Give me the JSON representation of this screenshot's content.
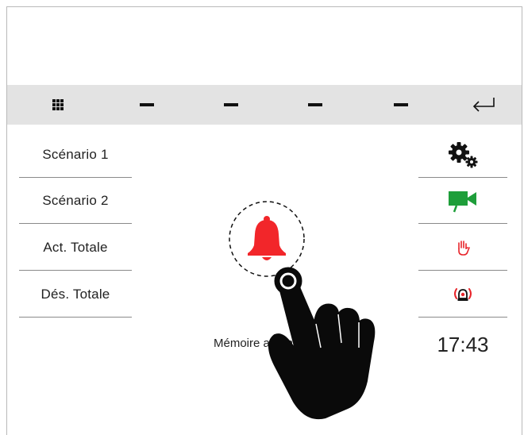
{
  "toolbar": {
    "items": [
      {
        "icon": "grid-icon"
      },
      {
        "icon": "dash-icon"
      },
      {
        "icon": "dash-icon"
      },
      {
        "icon": "dash-icon"
      },
      {
        "icon": "dash-icon"
      },
      {
        "icon": "return-arrow-icon"
      }
    ]
  },
  "left_menu": {
    "items": [
      {
        "label": "Scénario 1"
      },
      {
        "label": "Scénario 2"
      },
      {
        "label": "Act. Totale"
      },
      {
        "label": "Dés. Totale"
      }
    ]
  },
  "right_menu": {
    "items": [
      {
        "icon": "settings-gears-icon",
        "color": "#111111"
      },
      {
        "icon": "video-camera-icon",
        "color": "#1e9e3a"
      },
      {
        "icon": "hand-stop-icon",
        "color": "#e8242a"
      },
      {
        "icon": "siren-alarm-icon",
        "color": "#e8242a"
      }
    ],
    "clock": "17:43"
  },
  "center": {
    "bell_icon": "bell-icon",
    "bell_color": "#f2262a",
    "label": "Mémoire alarmes"
  },
  "overlay": {
    "icon": "pointing-hand-icon"
  }
}
